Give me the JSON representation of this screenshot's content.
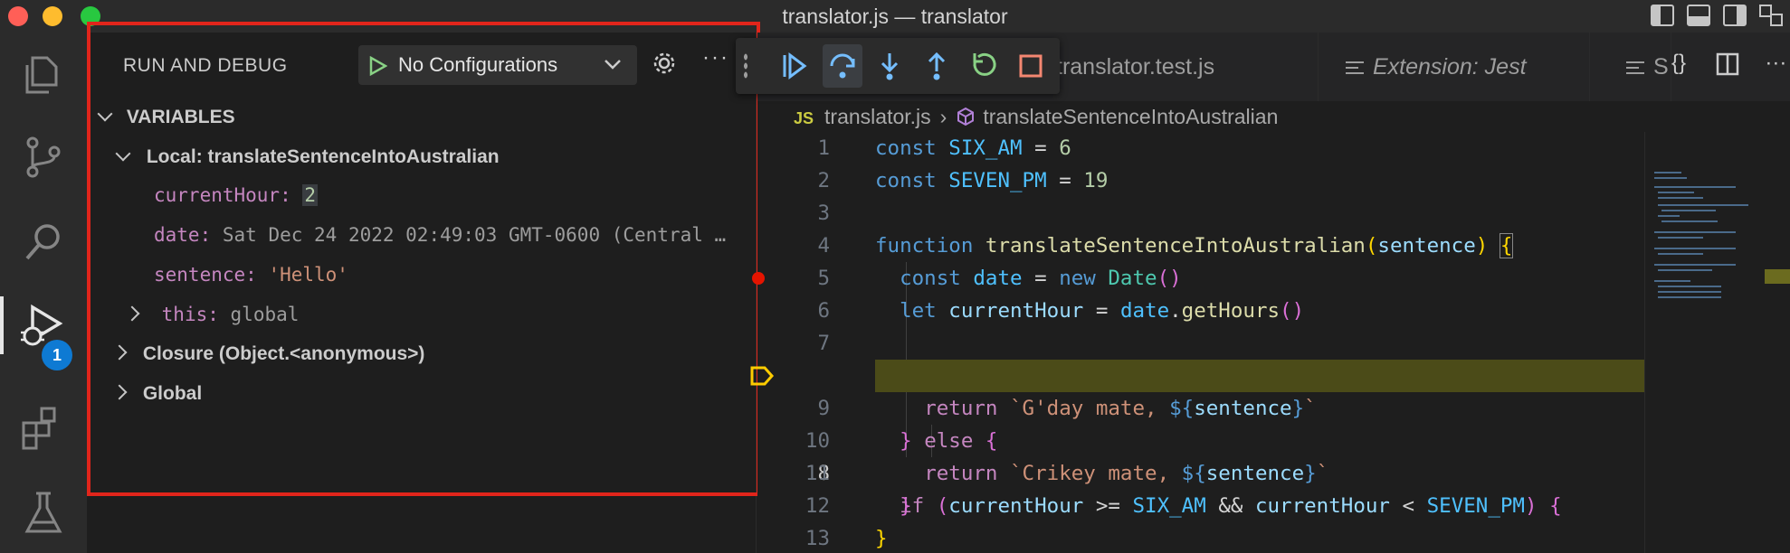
{
  "window": {
    "title": "translator.js — translator"
  },
  "activity_bar": {
    "items": [
      "explorer-icon",
      "source-control-icon",
      "search-icon",
      "run-debug-icon",
      "extensions-icon",
      "testing-icon"
    ],
    "debug_badge": "1"
  },
  "sidebar": {
    "title": "RUN AND DEBUG",
    "config_label": "No Configurations",
    "variables_header": "VARIABLES",
    "scopes": {
      "local": "Local: translateSentenceIntoAustralian",
      "closure": "Closure (Object.<anonymous>)",
      "global": "Global"
    },
    "vars": {
      "currentHour_name": "currentHour:",
      "currentHour_value": "2",
      "date_name": "date:",
      "date_value": "Sat Dec 24 2022 02:49:03 GMT-0600 (Central …",
      "sentence_name": "sentence:",
      "sentence_value": "'Hello'",
      "this_name": "this:",
      "this_value": "global"
    }
  },
  "editor": {
    "tabs": [
      {
        "label": "translator.test.js"
      },
      {
        "label": "Extension: Jest"
      },
      {
        "label": "S"
      }
    ],
    "breadcrumb": {
      "lang": "JS",
      "file": "translator.js",
      "symbol": "translateSentenceIntoAustralian"
    },
    "line_numbers": [
      "1",
      "2",
      "3",
      "4",
      "5",
      "6",
      "7",
      "8",
      "9",
      "10",
      "11",
      "12",
      "13"
    ],
    "current_line": "8",
    "breakpoint_line": "5"
  },
  "colors": {
    "accent": "#0e7ad3",
    "breakpoint": "#e51400",
    "highlight_frame": "#e1251b",
    "current_line_bg": "#4b4b18"
  }
}
